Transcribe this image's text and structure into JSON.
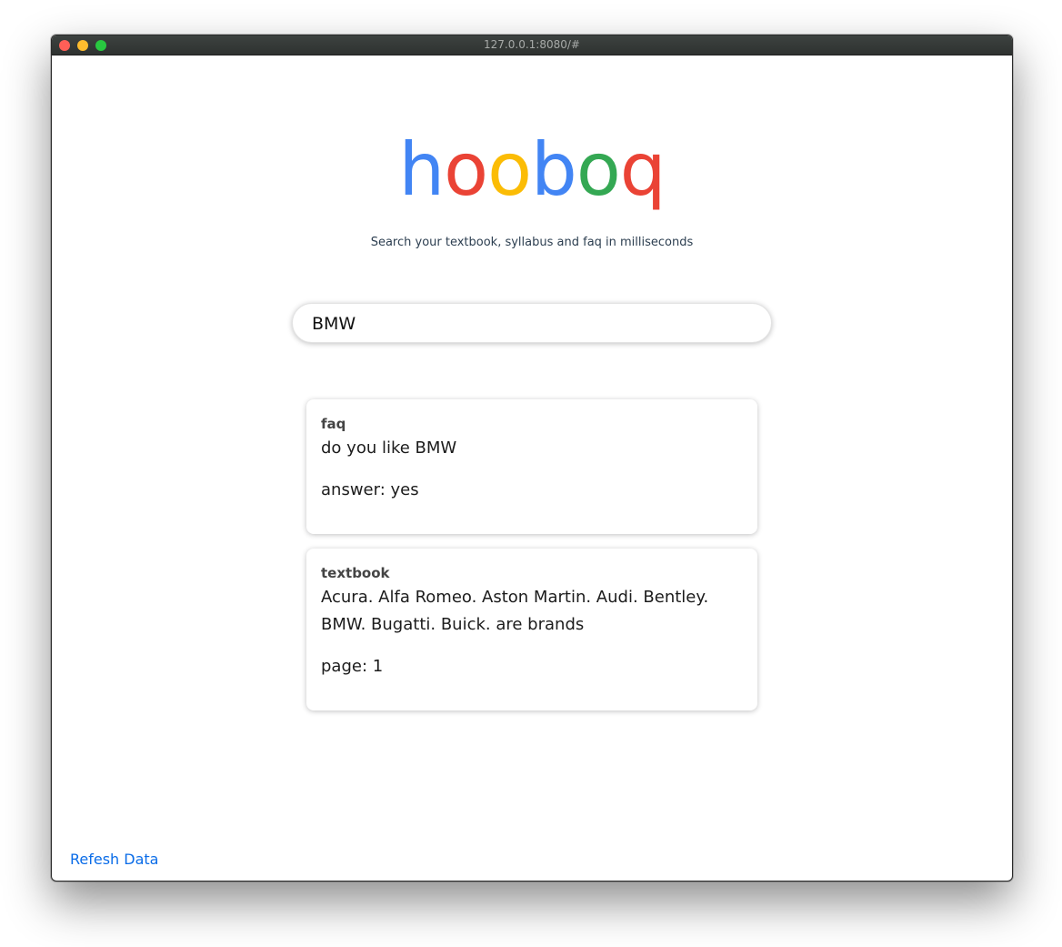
{
  "browser": {
    "url": "127.0.0.1:8080/#"
  },
  "logo": {
    "letters": [
      {
        "char": "h",
        "color": "#4285f4"
      },
      {
        "char": "o",
        "color": "#ea4335"
      },
      {
        "char": "o",
        "color": "#fbbc05"
      },
      {
        "char": "b",
        "color": "#4285f4"
      },
      {
        "char": "o",
        "color": "#34a853"
      },
      {
        "char": "q",
        "color": "#ea4335"
      }
    ]
  },
  "subtitle": "Search your textbook, syllabus and faq in milliseconds",
  "search": {
    "value": "BMW",
    "placeholder": ""
  },
  "results": [
    {
      "category": "faq",
      "text": "do you like BMW",
      "meta": "answer: yes"
    },
    {
      "category": "textbook",
      "text": "Acura. Alfa Romeo. Aston Martin. Audi. Bentley. BMW. Bugatti. Buick. are brands",
      "meta": "page: 1"
    }
  ],
  "footer": {
    "refresh_label": "Refesh Data"
  },
  "colors": {
    "link": "#0a6ce8"
  }
}
